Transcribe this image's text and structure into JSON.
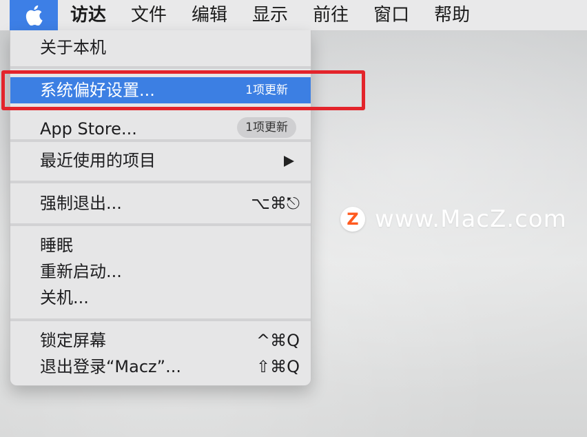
{
  "menubar": {
    "items": [
      {
        "label": "访达"
      },
      {
        "label": "文件"
      },
      {
        "label": "编辑"
      },
      {
        "label": "显示"
      },
      {
        "label": "前往"
      },
      {
        "label": "窗口"
      },
      {
        "label": "帮助"
      }
    ]
  },
  "apple_menu": {
    "about": "关于本机",
    "system_preferences": {
      "label": "系统偏好设置...",
      "badge": "1项更新"
    },
    "app_store": {
      "label": "App Store...",
      "badge": "1项更新"
    },
    "recent_items": "最近使用的项目",
    "force_quit": {
      "label": "强制退出...",
      "shortcut": "⌥⌘⎋"
    },
    "sleep": "睡眠",
    "restart": "重新启动...",
    "shutdown": "关机...",
    "lock_screen": {
      "label": "锁定屏幕",
      "shortcut": "^⌘Q"
    },
    "logout": {
      "label": "退出登录“Macz”...",
      "shortcut": "⇧⌘Q"
    }
  },
  "watermark": {
    "text": "www.MacZ.com",
    "logo_letter": "Z"
  },
  "colors": {
    "selection": "#3c7fe3",
    "annotation": "#e3242b",
    "watermark_logo": "#ff5a1f"
  }
}
